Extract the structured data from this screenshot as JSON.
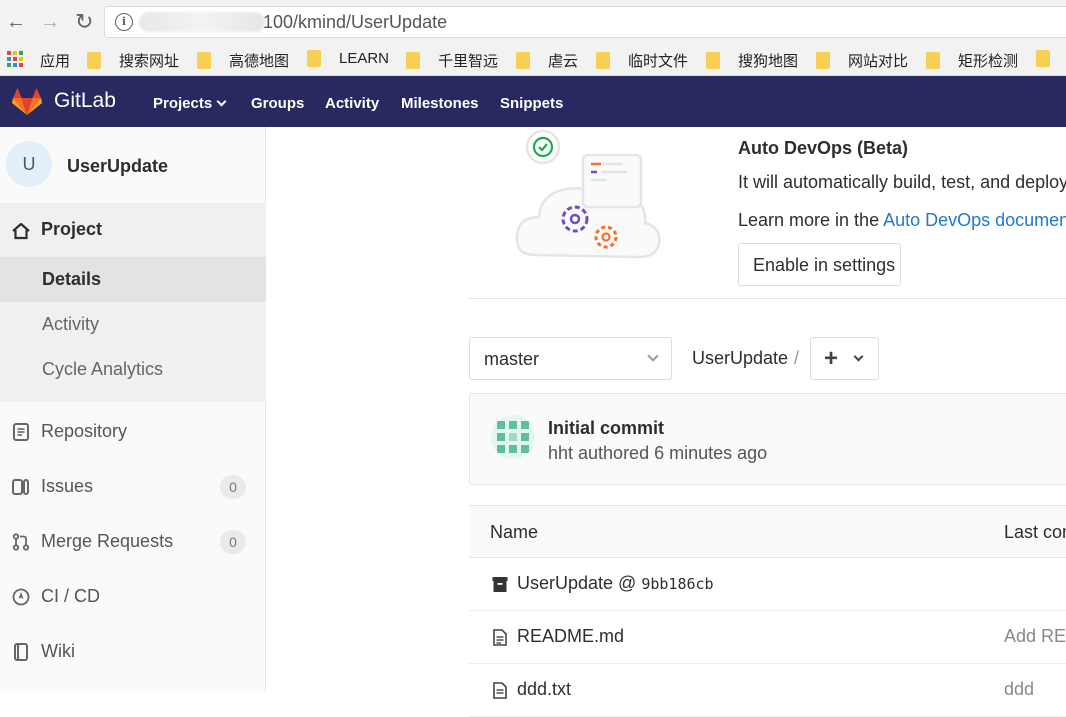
{
  "browser": {
    "back": "←",
    "forward": "→",
    "reload": "↻",
    "info": "i",
    "url": "100/kmind/UserUpdate"
  },
  "bookmarks": {
    "apps_label": "应用",
    "items": [
      "搜索网址",
      "高德地图",
      "LEARN",
      "千里智远",
      "虐云",
      "临时文件",
      "搜狗地图",
      "网站对比",
      "矩形检测"
    ]
  },
  "header": {
    "brand": "GitLab",
    "nav": [
      "Projects",
      "Groups",
      "Activity",
      "Milestones",
      "Snippets"
    ]
  },
  "sidebar": {
    "avatar_letter": "U",
    "project_name": "UserUpdate",
    "section_label": "Project",
    "sub_items": [
      "Details",
      "Activity",
      "Cycle Analytics"
    ],
    "items": [
      {
        "label": "Repository"
      },
      {
        "label": "Issues",
        "count": "0"
      },
      {
        "label": "Merge Requests",
        "count": "0"
      },
      {
        "label": "CI / CD"
      },
      {
        "label": "Wiki"
      }
    ]
  },
  "devops": {
    "title": "Auto DevOps (Beta)",
    "description": "It will automatically build, test, and deploy",
    "learn_prefix": "Learn more in the ",
    "learn_link": "Auto DevOps document",
    "enable_button": "Enable in settings"
  },
  "repo": {
    "branch": "master",
    "path": "UserUpdate",
    "path_sep": "/",
    "add_label": "+"
  },
  "commit": {
    "title": "Initial commit",
    "meta": "hht authored 6 minutes ago"
  },
  "tree": {
    "col_name": "Name",
    "col_last": "Last com",
    "rows": [
      {
        "name": "UserUpdate @ ",
        "hash": "9bb186cb",
        "msg": ""
      },
      {
        "name": "README.md",
        "hash": "",
        "msg": "Add REA"
      },
      {
        "name": "ddd.txt",
        "hash": "",
        "msg": "ddd"
      }
    ]
  },
  "colors": {
    "header_bg": "#292961",
    "link": "#1f78d1",
    "folder": "#f6cf53"
  }
}
